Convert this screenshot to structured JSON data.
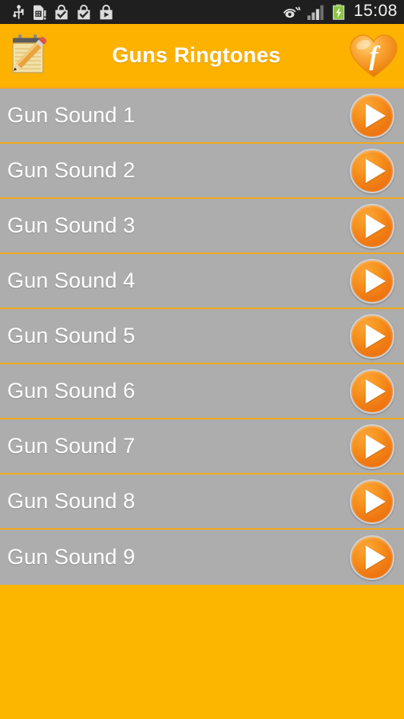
{
  "statusbar": {
    "icons_left": [
      {
        "name": "usb-icon",
        "label": "USB connected"
      },
      {
        "name": "sim-card-alert-icon",
        "label": "SIM card alert"
      },
      {
        "name": "app-installed-icon-1",
        "label": "App installed"
      },
      {
        "name": "app-installed-icon-2",
        "label": "App installed"
      },
      {
        "name": "play-store-icon",
        "label": "Play Store"
      }
    ],
    "icons_right": [
      {
        "name": "smart-stay-eye-icon",
        "label": "Smart stay"
      },
      {
        "name": "signal-bars-icon",
        "label": "Signal strength"
      },
      {
        "name": "battery-charging-icon",
        "label": "Battery charging"
      }
    ],
    "time": "15:08",
    "background": "#1f1f1f",
    "text_color": "#f2f2f2",
    "battery_color": "#8CC63F"
  },
  "titlebar": {
    "title": "Guns Ringtones",
    "left_icon": "notepad-pencil-icon",
    "right_icon": "heart-f-logo-icon",
    "background": "#FDB200",
    "title_color": "#FFFFFF"
  },
  "list": {
    "background": "#ADADAD",
    "divider_color": "#F0A91E",
    "label_color": "#FFFFFF",
    "play_button_color": "#F7931E",
    "rows": [
      {
        "label": "Gun Sound 1",
        "action": "play"
      },
      {
        "label": "Gun Sound 2",
        "action": "play"
      },
      {
        "label": "Gun Sound 3",
        "action": "play"
      },
      {
        "label": "Gun Sound 4",
        "action": "play"
      },
      {
        "label": "Gun Sound 5",
        "action": "play"
      },
      {
        "label": "Gun Sound 6",
        "action": "play"
      },
      {
        "label": "Gun Sound 7",
        "action": "play"
      },
      {
        "label": "Gun Sound 8",
        "action": "play"
      },
      {
        "label": "Gun Sound 9",
        "action": "play"
      }
    ]
  },
  "footer": {
    "background": "#FDB600"
  }
}
